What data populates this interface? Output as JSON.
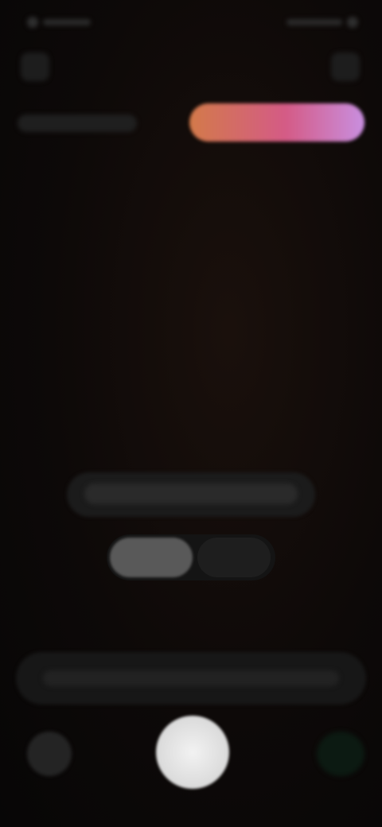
{
  "status_bar": {},
  "top_bar": {},
  "tabs": {},
  "viewfinder": {},
  "hint": {},
  "mode_toggle": {},
  "quick_bar": {},
  "controls": {}
}
